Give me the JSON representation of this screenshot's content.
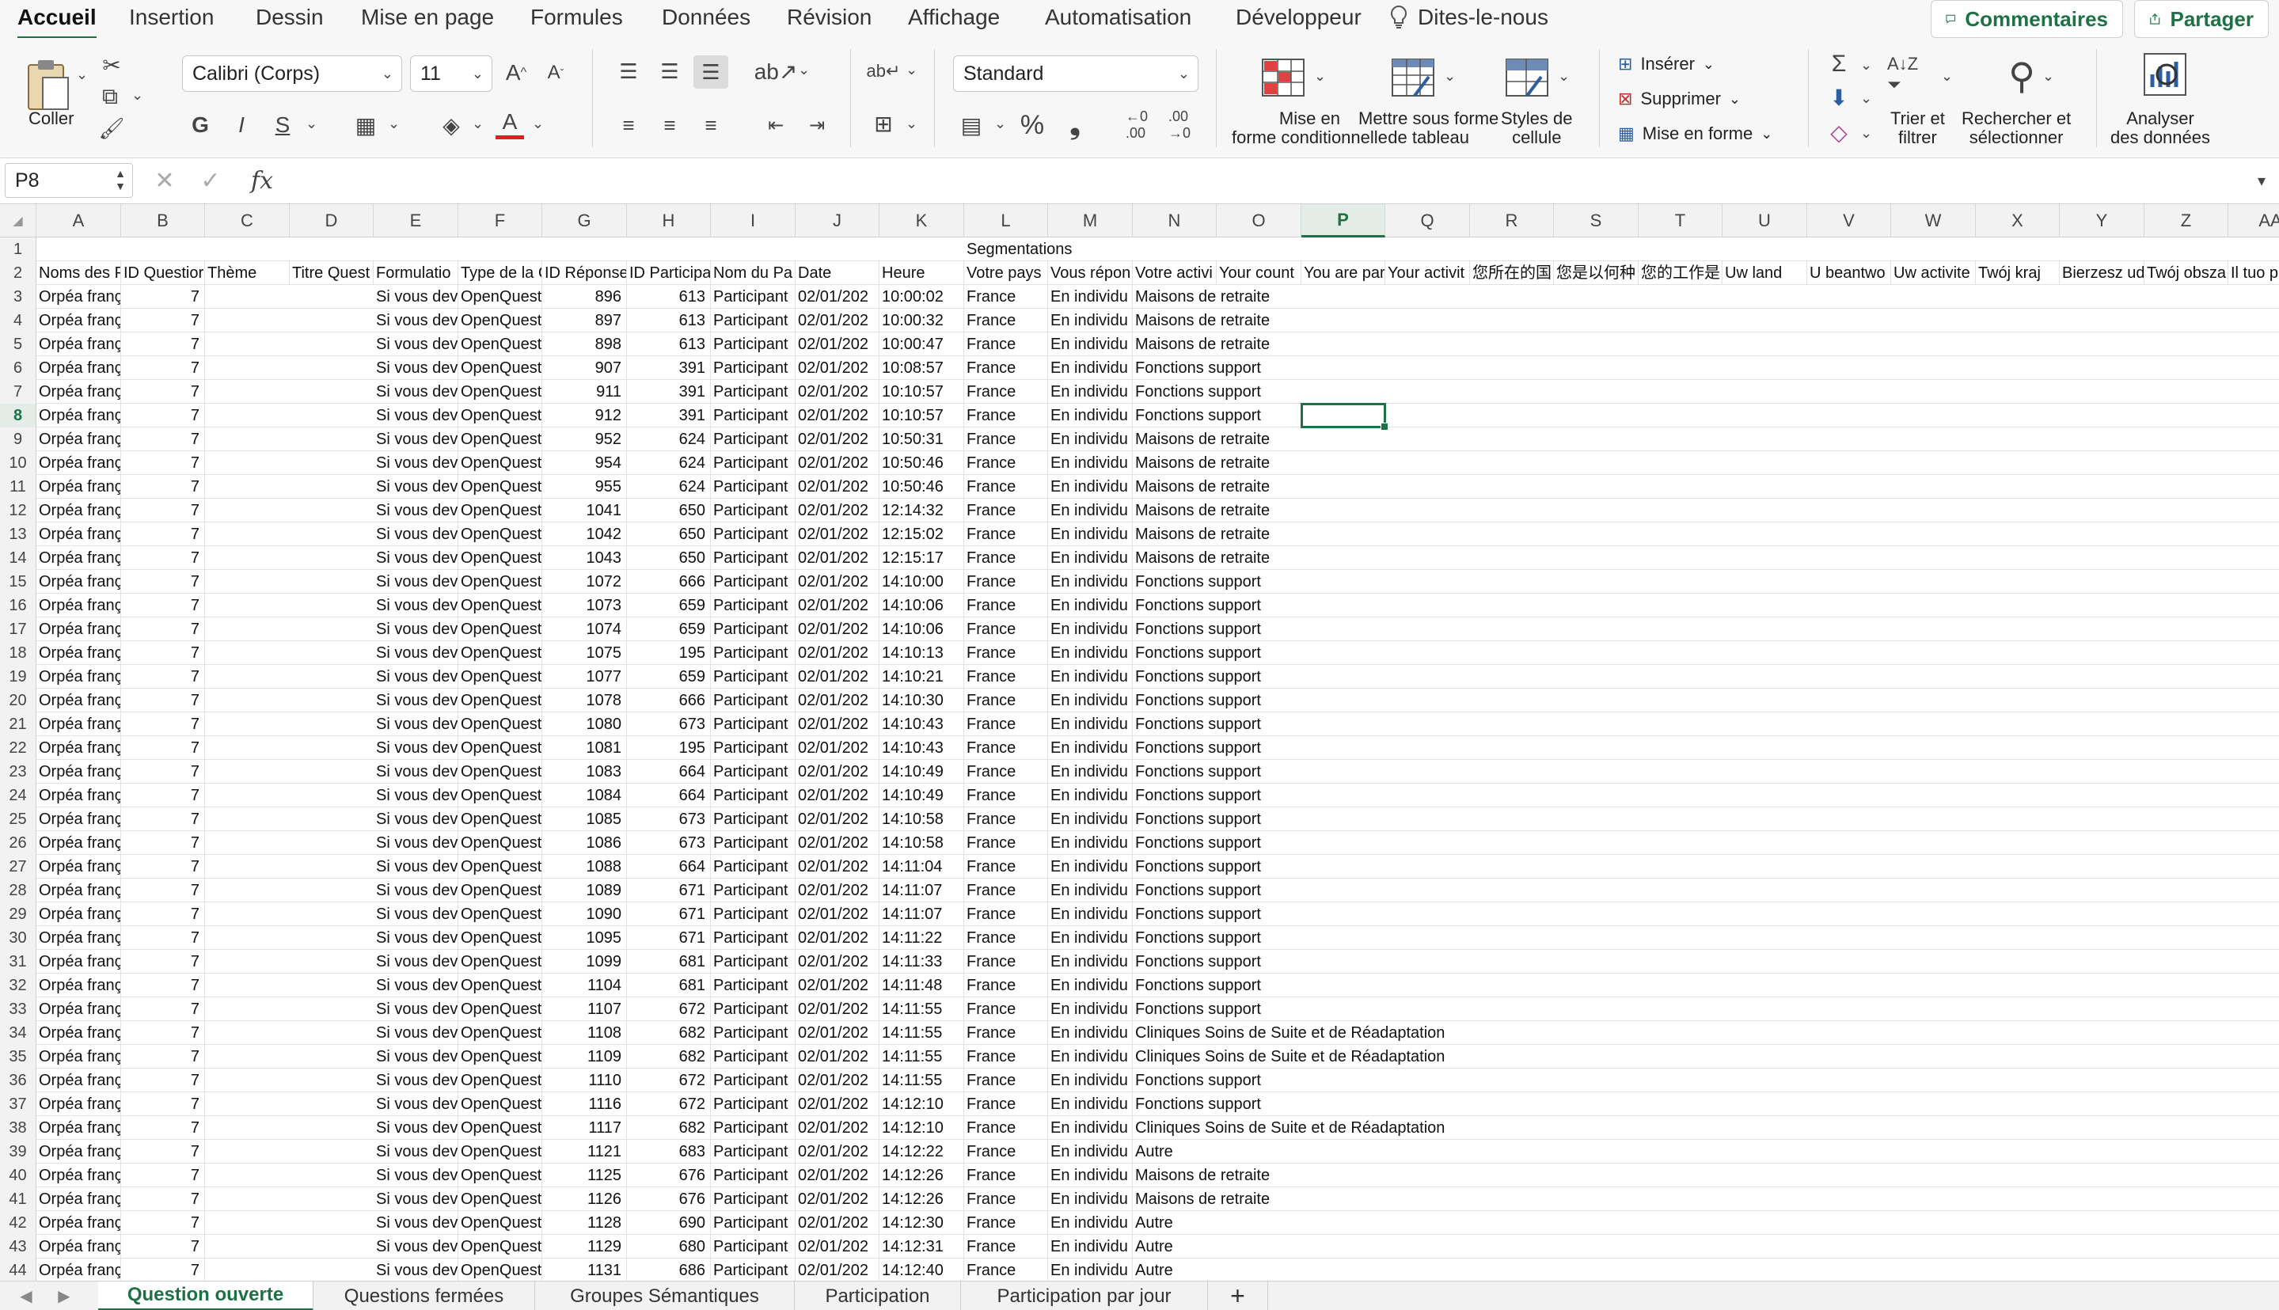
{
  "ribbon_tabs": [
    "Accueil",
    "Insertion",
    "Dessin",
    "Mise en page",
    "Formules",
    "Données",
    "Révision",
    "Affichage",
    "Automatisation",
    "Développeur"
  ],
  "tell_me": "Dites-le-nous",
  "comments_label": "Commentaires",
  "share_label": "Partager",
  "ribbon": {
    "paste_label": "Coller",
    "font_name": "Calibri (Corps)",
    "font_size": "11",
    "bold": "G",
    "italic": "I",
    "underline": "S",
    "number_format": "Standard",
    "percent": "%",
    "comma": "❟",
    "cond_format_label": "Mise en forme conditionnelle",
    "table_format_label": "Mettre sous forme de tableau",
    "cell_styles_label": "Styles de cellule",
    "insert_label": "Insérer",
    "delete_label": "Supprimer",
    "format_label": "Mise en forme",
    "sort_filter_label": "Trier et filtrer",
    "find_select_label": "Rechercher et sélectionner",
    "analyze_label": "Analyser des données"
  },
  "formula_bar": {
    "name_box": "P8",
    "fx": "fx",
    "formula": ""
  },
  "selected": {
    "col": "P",
    "row": 8
  },
  "columns": [
    "A",
    "B",
    "C",
    "D",
    "E",
    "F",
    "G",
    "H",
    "I",
    "J",
    "K",
    "L",
    "M",
    "N",
    "O",
    "P",
    "Q",
    "R",
    "S",
    "T",
    "U",
    "V",
    "W",
    "X",
    "Y",
    "Z",
    "AA"
  ],
  "row1": {
    "L": "Segmentations"
  },
  "headers": [
    "Noms des P",
    "ID Questior",
    "Thème",
    "Titre Quest",
    "Formulatio",
    "Type de la C",
    "ID Réponse",
    "ID Participa",
    "Nom du Pa",
    "Date",
    "Heure",
    "Votre pays",
    "Vous répon",
    "Votre activi",
    "Your count",
    "You are par",
    "Your activit",
    "您所在的国",
    "您是以何种",
    "您的工作是",
    "Uw land",
    "U beantwo",
    "Uw activite",
    "Twój kraj",
    "Bierzesz ud",
    "Twój obsza",
    "Il tuo pa"
  ],
  "common": {
    "a": "Orpéa franç",
    "b": "7",
    "e": "Si vous devi",
    "f": "OpenQuest",
    "i": "Participant",
    "j": "02/01/202",
    "l": "France",
    "m": "En individu"
  },
  "data_rows": [
    {
      "n": 3,
      "g": "896",
      "h": "613",
      "k": "10:00:02",
      "act": "Maisons de retraite"
    },
    {
      "n": 4,
      "g": "897",
      "h": "613",
      "k": "10:00:32",
      "act": "Maisons de retraite"
    },
    {
      "n": 5,
      "g": "898",
      "h": "613",
      "k": "10:00:47",
      "act": "Maisons de retraite"
    },
    {
      "n": 6,
      "g": "907",
      "h": "391",
      "k": "10:08:57",
      "act": "Fonctions support"
    },
    {
      "n": 7,
      "g": "911",
      "h": "391",
      "k": "10:10:57",
      "act": "Fonctions support"
    },
    {
      "n": 8,
      "g": "912",
      "h": "391",
      "k": "10:10:57",
      "act": "Fonctions support"
    },
    {
      "n": 9,
      "g": "952",
      "h": "624",
      "k": "10:50:31",
      "act": "Maisons de retraite"
    },
    {
      "n": 10,
      "g": "954",
      "h": "624",
      "k": "10:50:46",
      "act": "Maisons de retraite"
    },
    {
      "n": 11,
      "g": "955",
      "h": "624",
      "k": "10:50:46",
      "act": "Maisons de retraite"
    },
    {
      "n": 12,
      "g": "1041",
      "h": "650",
      "k": "12:14:32",
      "act": "Maisons de retraite"
    },
    {
      "n": 13,
      "g": "1042",
      "h": "650",
      "k": "12:15:02",
      "act": "Maisons de retraite"
    },
    {
      "n": 14,
      "g": "1043",
      "h": "650",
      "k": "12:15:17",
      "act": "Maisons de retraite"
    },
    {
      "n": 15,
      "g": "1072",
      "h": "666",
      "k": "14:10:00",
      "act": "Fonctions support"
    },
    {
      "n": 16,
      "g": "1073",
      "h": "659",
      "k": "14:10:06",
      "act": "Fonctions support"
    },
    {
      "n": 17,
      "g": "1074",
      "h": "659",
      "k": "14:10:06",
      "act": "Fonctions support"
    },
    {
      "n": 18,
      "g": "1075",
      "h": "195",
      "k": "14:10:13",
      "act": "Fonctions support"
    },
    {
      "n": 19,
      "g": "1077",
      "h": "659",
      "k": "14:10:21",
      "act": "Fonctions support"
    },
    {
      "n": 20,
      "g": "1078",
      "h": "666",
      "k": "14:10:30",
      "act": "Fonctions support"
    },
    {
      "n": 21,
      "g": "1080",
      "h": "673",
      "k": "14:10:43",
      "act": "Fonctions support"
    },
    {
      "n": 22,
      "g": "1081",
      "h": "195",
      "k": "14:10:43",
      "act": "Fonctions support"
    },
    {
      "n": 23,
      "g": "1083",
      "h": "664",
      "k": "14:10:49",
      "act": "Fonctions support"
    },
    {
      "n": 24,
      "g": "1084",
      "h": "664",
      "k": "14:10:49",
      "act": "Fonctions support"
    },
    {
      "n": 25,
      "g": "1085",
      "h": "673",
      "k": "14:10:58",
      "act": "Fonctions support"
    },
    {
      "n": 26,
      "g": "1086",
      "h": "673",
      "k": "14:10:58",
      "act": "Fonctions support"
    },
    {
      "n": 27,
      "g": "1088",
      "h": "664",
      "k": "14:11:04",
      "act": "Fonctions support"
    },
    {
      "n": 28,
      "g": "1089",
      "h": "671",
      "k": "14:11:07",
      "act": "Fonctions support"
    },
    {
      "n": 29,
      "g": "1090",
      "h": "671",
      "k": "14:11:07",
      "act": "Fonctions support"
    },
    {
      "n": 30,
      "g": "1095",
      "h": "671",
      "k": "14:11:22",
      "act": "Fonctions support"
    },
    {
      "n": 31,
      "g": "1099",
      "h": "681",
      "k": "14:11:33",
      "act": "Fonctions support"
    },
    {
      "n": 32,
      "g": "1104",
      "h": "681",
      "k": "14:11:48",
      "act": "Fonctions support"
    },
    {
      "n": 33,
      "g": "1107",
      "h": "672",
      "k": "14:11:55",
      "act": "Fonctions support"
    },
    {
      "n": 34,
      "g": "1108",
      "h": "682",
      "k": "14:11:55",
      "act": "Cliniques Soins de Suite et de Réadaptation"
    },
    {
      "n": 35,
      "g": "1109",
      "h": "682",
      "k": "14:11:55",
      "act": "Cliniques Soins de Suite et de Réadaptation"
    },
    {
      "n": 36,
      "g": "1110",
      "h": "672",
      "k": "14:11:55",
      "act": "Fonctions support"
    },
    {
      "n": 37,
      "g": "1116",
      "h": "672",
      "k": "14:12:10",
      "act": "Fonctions support"
    },
    {
      "n": 38,
      "g": "1117",
      "h": "682",
      "k": "14:12:10",
      "act": "Cliniques Soins de Suite et de Réadaptation"
    },
    {
      "n": 39,
      "g": "1121",
      "h": "683",
      "k": "14:12:22",
      "act": "Autre"
    },
    {
      "n": 40,
      "g": "1125",
      "h": "676",
      "k": "14:12:26",
      "act": "Maisons de retraite"
    },
    {
      "n": 41,
      "g": "1126",
      "h": "676",
      "k": "14:12:26",
      "act": "Maisons de retraite"
    },
    {
      "n": 42,
      "g": "1128",
      "h": "690",
      "k": "14:12:30",
      "act": "Autre"
    },
    {
      "n": 43,
      "g": "1129",
      "h": "680",
      "k": "14:12:31",
      "act": "Autre"
    },
    {
      "n": 44,
      "g": "1131",
      "h": "686",
      "k": "14:12:40",
      "act": "Autre"
    }
  ],
  "sheet_tabs": [
    "Question ouverte",
    "Questions fermées",
    "Groupes Sémantiques",
    "Participation",
    "Participation par jour"
  ],
  "add_sheet": "+",
  "colors": {
    "accent": "#1e7145",
    "grid": "#e2e2e2",
    "header_bg": "#f2f2f2"
  }
}
